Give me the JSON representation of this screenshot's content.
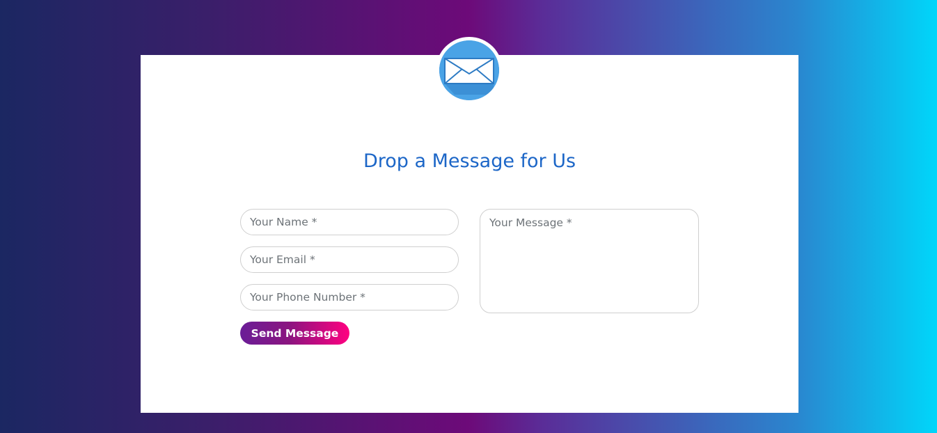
{
  "page": {
    "title": "Drop a Message for Us"
  },
  "form": {
    "name_placeholder": "Your Name *",
    "email_placeholder": "Your Email *",
    "phone_placeholder": "Your Phone Number *",
    "message_placeholder": "Your Message *",
    "send_label": "Send Message"
  },
  "icons": {
    "logo": "envelope-icon"
  },
  "colors": {
    "title": "#1c66c7",
    "button_gradient_start": "#6a1d97",
    "button_gradient_end": "#ff0080",
    "background_start": "#1b2762",
    "background_mid": "#6d0a79",
    "background_end": "#00d6fa"
  }
}
